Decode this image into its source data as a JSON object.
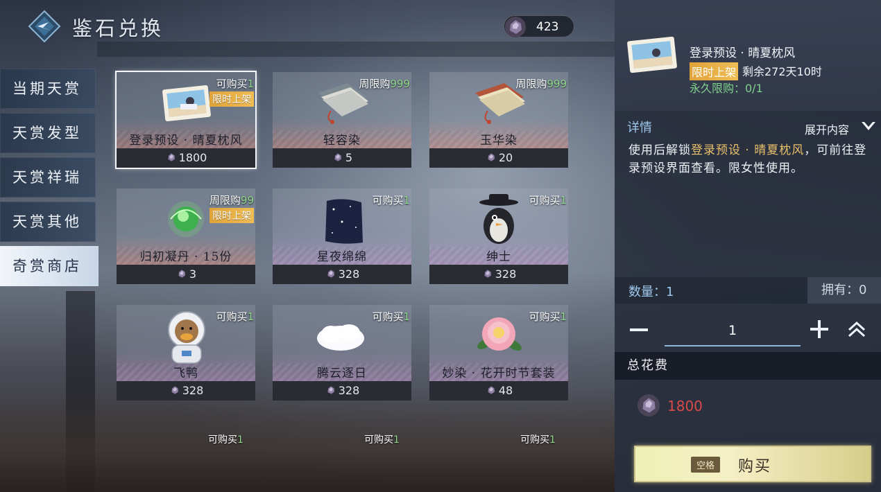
{
  "header": {
    "title": "鉴石兑换",
    "currency_value": "423"
  },
  "nav": [
    {
      "label": "当期天赏",
      "active": false
    },
    {
      "label": "天赏发型",
      "active": false
    },
    {
      "label": "天赏祥瑞",
      "active": false
    },
    {
      "label": "天赏其他",
      "active": false
    },
    {
      "label": "奇赏商店",
      "active": true
    }
  ],
  "items": [
    {
      "name": "登录预设 · 晴夏枕风",
      "price": "1800",
      "limit_prefix": "可购买",
      "limit_num": "1",
      "badge": "限时上架",
      "icon": "postcard-icon",
      "selected": true
    },
    {
      "name": "轻容染",
      "price": "5",
      "limit_prefix": "周限购",
      "limit_num": "999",
      "badge": "",
      "icon": "dye-book-icon"
    },
    {
      "name": "玉华染",
      "price": "20",
      "limit_prefix": "周限购",
      "limit_num": "999",
      "badge": "",
      "icon": "dye-book-icon"
    },
    {
      "name": "归初凝丹 · 15份",
      "price": "3",
      "limit_prefix": "周限购",
      "limit_num": "99",
      "badge": "限时上架",
      "icon": "green-pill-icon"
    },
    {
      "name": "星夜绵绵",
      "price": "328",
      "limit_prefix": "可购买",
      "limit_num": "1",
      "badge": "",
      "icon": "starry-night-icon"
    },
    {
      "name": "绅士",
      "price": "328",
      "limit_prefix": "可购买",
      "limit_num": "1",
      "badge": "",
      "icon": "penguin-gentleman-icon"
    },
    {
      "name": "飞鸭",
      "price": "328",
      "limit_prefix": "可购买",
      "limit_num": "1",
      "badge": "",
      "icon": "astronaut-duck-icon"
    },
    {
      "name": "腾云逐日",
      "price": "328",
      "limit_prefix": "可购买",
      "limit_num": "1",
      "badge": "",
      "icon": "cloud-icon"
    },
    {
      "name": "妙染 · 花开时节套装",
      "price": "48",
      "limit_prefix": "可购买",
      "limit_num": "1",
      "badge": "",
      "icon": "peony-icon"
    }
  ],
  "peek_row": [
    {
      "limit_prefix": "可购买",
      "limit_num": "1"
    },
    {
      "limit_prefix": "可购买",
      "limit_num": "1"
    },
    {
      "limit_prefix": "可购买",
      "limit_num": "1"
    }
  ],
  "detail": {
    "item_name": "登录预设 · 晴夏枕风",
    "badge": "限时上架",
    "remain": "剩余272天10时",
    "perm_limit": "永久限购：0/1",
    "section_title": "详情",
    "expand_label": "展开内容",
    "desc_before": "使用后解锁",
    "desc_highlight": "登录预设 · 晴夏枕风",
    "desc_after": "，可前往登录预设界面查看。限女性使用。",
    "qty_label": "数量：1",
    "own_label": "拥有：0",
    "qty_value": "1",
    "total_label": "总花费",
    "total_value": "1800",
    "key_hint": "空格",
    "buy_label": "购买"
  }
}
